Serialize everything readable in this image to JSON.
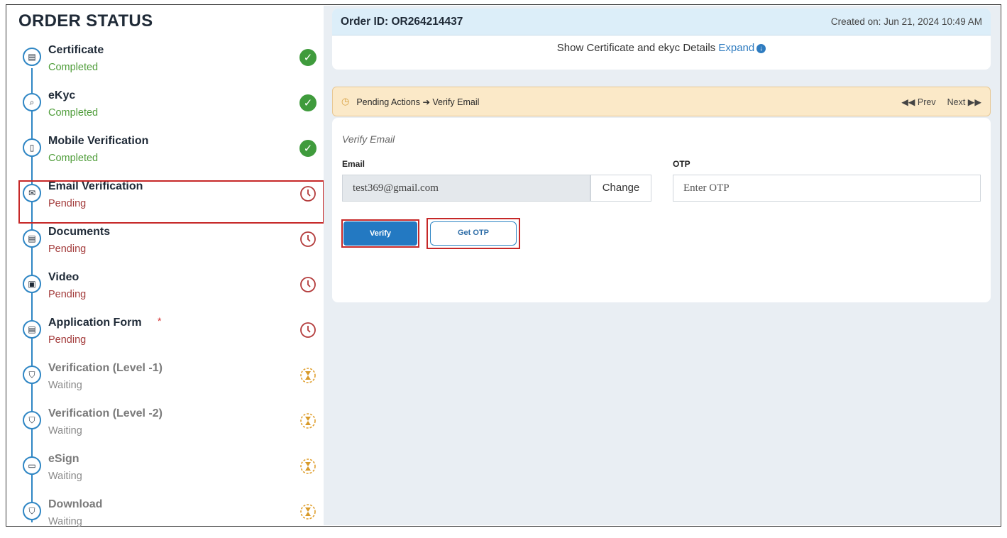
{
  "sidebar": {
    "title": "ORDER STATUS",
    "steps": [
      {
        "name": "Certificate",
        "state": "Completed",
        "kind": "completed",
        "icon": "certificate-icon"
      },
      {
        "name": "eKyc",
        "state": "Completed",
        "kind": "completed",
        "icon": "search-icon"
      },
      {
        "name": "Mobile Verification",
        "state": "Completed",
        "kind": "completed",
        "icon": "mobile-icon"
      },
      {
        "name": "Email Verification",
        "state": "Pending",
        "kind": "pending",
        "icon": "mail-icon"
      },
      {
        "name": "Documents",
        "state": "Pending",
        "kind": "pending",
        "icon": "document-icon"
      },
      {
        "name": "Video",
        "state": "Pending",
        "kind": "pending",
        "icon": "video-icon"
      },
      {
        "name": "Application Form",
        "state": "Pending",
        "kind": "pending",
        "icon": "form-icon",
        "required_mark": "*"
      },
      {
        "name": "Verification (Level -1)",
        "state": "Waiting",
        "kind": "waiting",
        "icon": "shield-icon"
      },
      {
        "name": "Verification (Level -2)",
        "state": "Waiting",
        "kind": "waiting",
        "icon": "shield-icon"
      },
      {
        "name": "eSign",
        "state": "Waiting",
        "kind": "waiting",
        "icon": "card-icon"
      },
      {
        "name": "Download",
        "state": "Waiting",
        "kind": "waiting",
        "icon": "shield-icon"
      }
    ]
  },
  "order": {
    "id_label": "Order ID: OR264214437",
    "created": "Created on: Jun 21, 2024 10:49 AM",
    "details_text": "Show Certificate and ekyc Details",
    "expand_label": "Expand"
  },
  "pending_bar": {
    "text": "Pending Actions ➔ Verify Email",
    "prev_label": "◀◀ Prev",
    "next_label": "Next ▶▶"
  },
  "form": {
    "title": "Verify Email",
    "email_label": "Email",
    "email_value": "test369@gmail.com",
    "change_label": "Change",
    "otp_label": "OTP",
    "otp_placeholder": "Enter OTP",
    "verify_label": "Verify",
    "get_otp_label": "Get OTP"
  },
  "colors": {
    "accent": "#2379c2",
    "completed": "#3f9b3c",
    "pending": "#a33b3b",
    "waiting": "#d8a040",
    "highlight": "#c62828"
  }
}
